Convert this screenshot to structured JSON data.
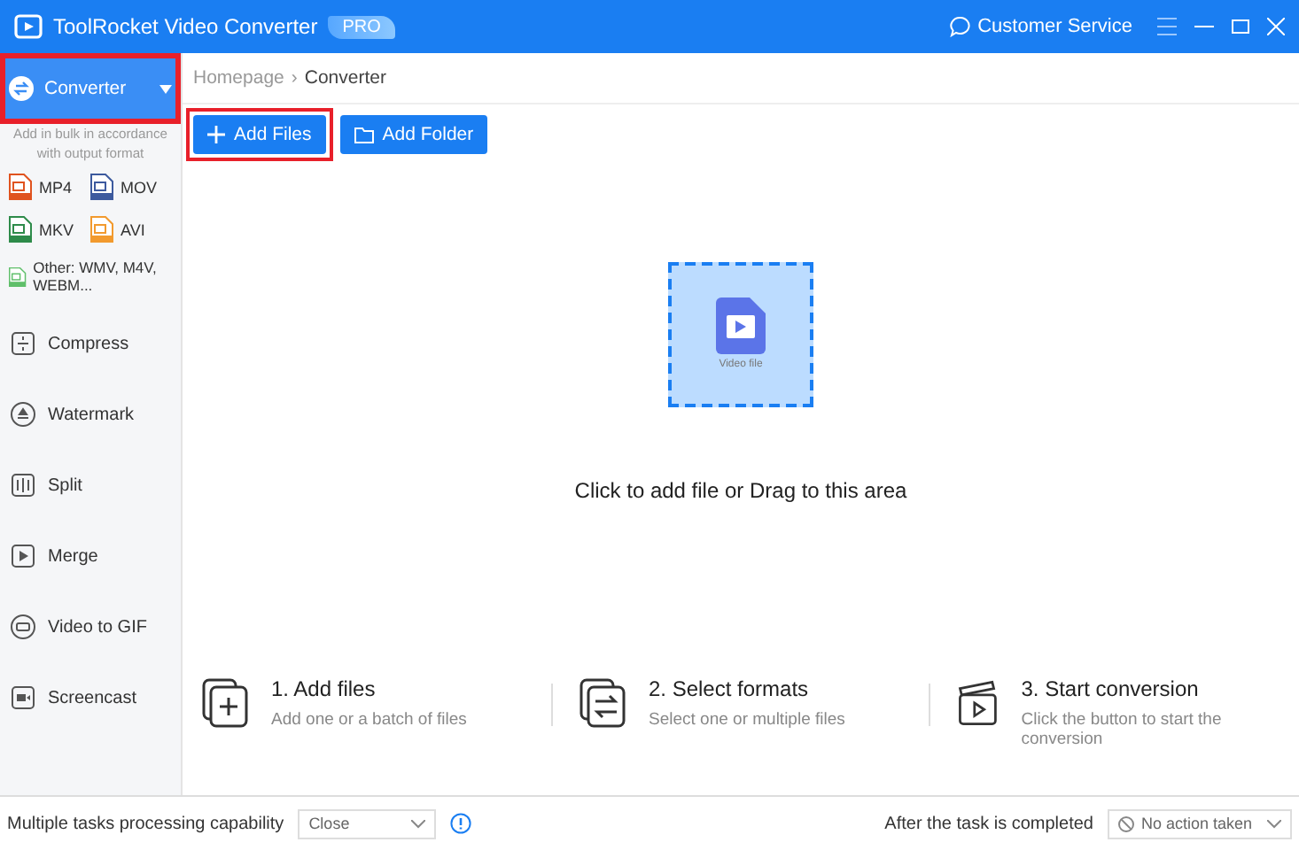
{
  "window": {
    "title": "ToolRocket Video Converter",
    "badge": "PRO",
    "service": "Customer Service"
  },
  "sidebar": {
    "items": [
      {
        "label": "Converter",
        "selected": true,
        "highlighted": true,
        "kind": "converter",
        "description": "Add in bulk in accordance with output format",
        "formats": [
          {
            "label": "MP4",
            "color": "#e0531f"
          },
          {
            "label": "MOV",
            "color": "#3d5a9e"
          },
          {
            "label": "MKV",
            "color": "#2e8b4a"
          },
          {
            "label": "AVI",
            "color": "#f29a2e"
          },
          {
            "label": "Other: WMV, M4V, WEBM...",
            "color": "#5fbf6a"
          }
        ]
      },
      {
        "label": "Compress",
        "selected": false,
        "highlighted": false,
        "kind": "compress"
      },
      {
        "label": "Watermark",
        "selected": false,
        "highlighted": false,
        "kind": "watermark"
      },
      {
        "label": "Split",
        "selected": false,
        "highlighted": false,
        "kind": "split"
      },
      {
        "label": "Merge",
        "selected": false,
        "highlighted": false,
        "kind": "merge"
      },
      {
        "label": "Video to GIF",
        "selected": false,
        "highlighted": false,
        "kind": "gif"
      },
      {
        "label": "Screencast",
        "selected": false,
        "highlighted": false,
        "kind": "screencast"
      }
    ]
  },
  "breadcrumb": {
    "items": [
      "Homepage",
      "Converter"
    ],
    "separator": "›"
  },
  "toolbar": [
    {
      "label": "Add Files",
      "kind": "files",
      "highlighted": true
    },
    {
      "label": "Add Folder",
      "kind": "folder",
      "highlighted": false
    }
  ],
  "dropzone": {
    "icon_label": "Video file",
    "prompt": "Click to add file or Drag to this area"
  },
  "steps": [
    {
      "kind": "add",
      "title": "1. Add files",
      "text": "Add one or a batch of files"
    },
    {
      "kind": "formats",
      "title": "2. Select formats",
      "text": "Select one or multiple files"
    },
    {
      "kind": "start",
      "title": "3. Start conversion",
      "text": "Click the button to start the conversion"
    }
  ],
  "status_bar": {
    "tasks_label": "Multiple tasks processing capability",
    "tasks_value": "Close",
    "after_label": "After the task is completed",
    "after_value": "No action taken"
  }
}
